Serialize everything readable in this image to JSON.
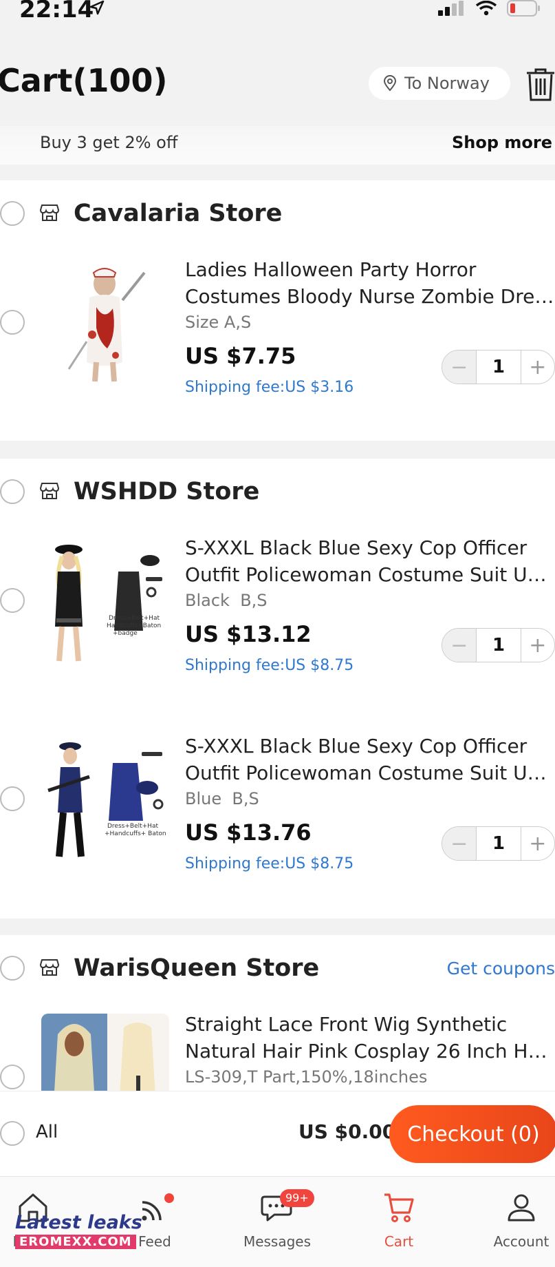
{
  "status": {
    "time": "22:14"
  },
  "header": {
    "title": "Cart(100)",
    "destination": "To Norway"
  },
  "promo": {
    "text": "Buy 3 get 2% off",
    "shop_more": "Shop more"
  },
  "stores": [
    {
      "name": "Cavalaria Store",
      "items": [
        {
          "title_line1": "Ladies Halloween Party Horror",
          "title_line2": "Costumes Bloody Nurse Zombie Dress...",
          "sku": "Size A,S",
          "price": "US $7.75",
          "shipping": "Shipping fee:US $3.16",
          "qty": "1"
        }
      ]
    },
    {
      "name": "WSHDD Store",
      "items": [
        {
          "title_line1": "S-XXXL Black Blue Sexy Cop Officer",
          "title_line2": "Outfit Policewoman Costume Suit Unif...",
          "sku": "Black  B,S",
          "price": "US $13.12",
          "shipping": "Shipping fee:US $8.75",
          "qty": "1",
          "img_caption": "Dress+Belt+Hat Handcuffs+Baton +badge"
        },
        {
          "title_line1": "S-XXXL Black Blue Sexy Cop Officer",
          "title_line2": "Outfit Policewoman Costume Suit Unif...",
          "sku": "Blue  B,S",
          "price": "US $13.76",
          "shipping": "Shipping fee:US $8.75",
          "qty": "1",
          "img_caption": "Dress+Belt+Hat +Handcuffs+ Baton"
        }
      ]
    },
    {
      "name": "WarisQueen Store",
      "coupon_label": "Get coupons",
      "items": [
        {
          "title_line1": "Straight Lace Front Wig Synthetic",
          "title_line2": "Natural Hair Pink Cosplay 26 Inch Hea...",
          "sku": "LS-309,T Part,150%,18inches"
        }
      ]
    }
  ],
  "checkout": {
    "all_label": "All",
    "total": "US $0.00",
    "button": "Checkout (0)"
  },
  "tabs": [
    {
      "label": "Home",
      "icon": "home-icon"
    },
    {
      "label": "Feed",
      "icon": "feed-icon"
    },
    {
      "label": "Messages",
      "icon": "messages-icon",
      "badge": "99+"
    },
    {
      "label": "Cart",
      "icon": "cart-icon"
    },
    {
      "label": "Account",
      "icon": "account-icon"
    }
  ],
  "watermark": {
    "title": "Latest leaks",
    "subtitle": "EROMEXX.COM"
  },
  "colors": {
    "accent": "#e8461a",
    "link": "#2f78d0",
    "badge": "#f0443c"
  }
}
